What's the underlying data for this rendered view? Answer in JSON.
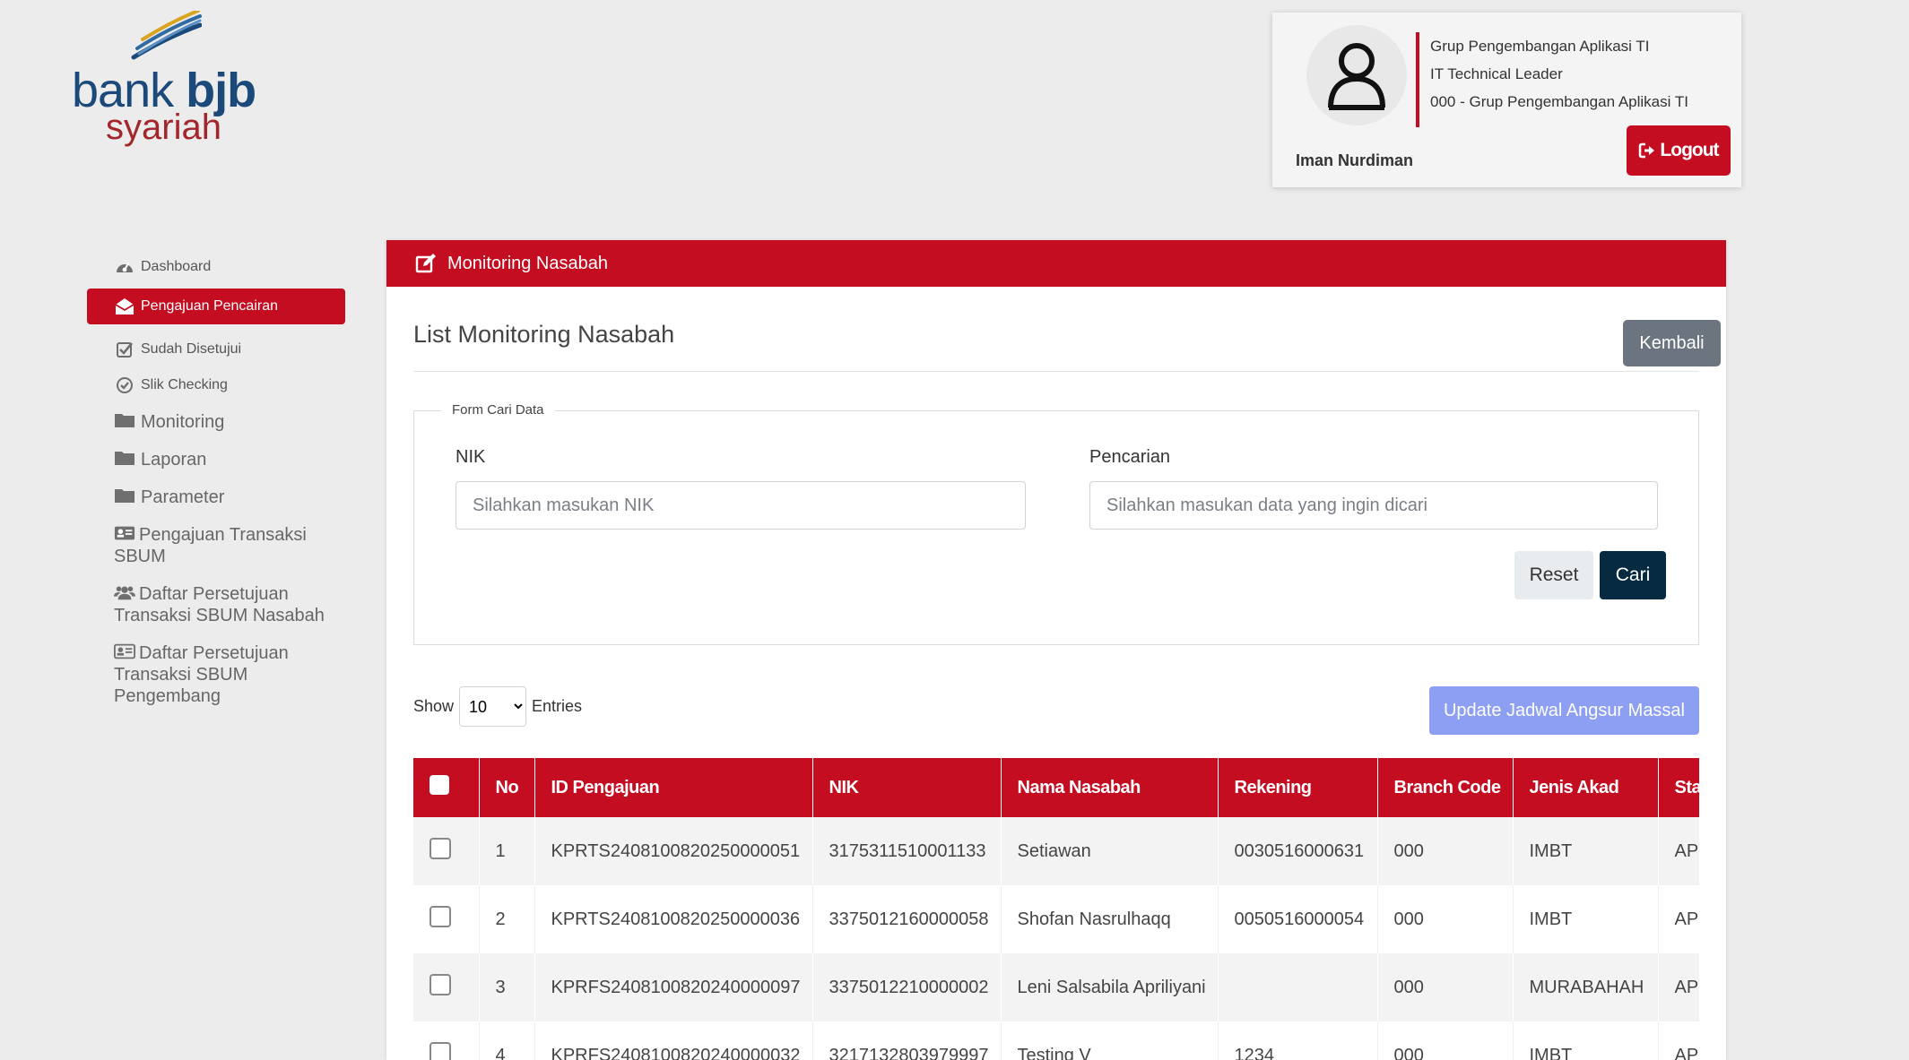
{
  "brand": {
    "bank_word": "bank",
    "bjb_word": "bjb",
    "syariah_word": "syariah"
  },
  "profile": {
    "name": "Iman Nurdiman",
    "info": [
      "Grup Pengembangan Aplikasi TI",
      "IT Technical Leader",
      "000 - Grup Pengembangan Aplikasi TI"
    ],
    "logout_label": "Logout"
  },
  "sidebar": {
    "items": [
      {
        "label": "Dashboard",
        "icon": "dashboard-icon"
      },
      {
        "label": "Pengajuan Pencairan",
        "icon": "envelope-open-icon",
        "active": true
      },
      {
        "label": "Sudah Disetujui",
        "icon": "check-square-icon"
      },
      {
        "label": "Slik Checking",
        "icon": "check-circle-icon"
      },
      {
        "label": "Monitoring",
        "icon": "folder-icon"
      },
      {
        "label": "Laporan",
        "icon": "folder-icon"
      },
      {
        "label": "Parameter",
        "icon": "folder-icon"
      },
      {
        "label": "Pengajuan Transaksi SBUM",
        "icon": "id-card-icon"
      },
      {
        "label": "Daftar Persetujuan Transaksi SBUM Nasabah",
        "icon": "users-icon"
      },
      {
        "label": "Daftar Persetujuan Transaksi SBUM Pengembang",
        "icon": "id-card-icon"
      }
    ]
  },
  "main": {
    "header_title": "Monitoring Nasabah",
    "list_title": "List Monitoring Nasabah",
    "back_label": "Kembali",
    "search": {
      "legend": "Form Cari Data",
      "nik_label": "NIK",
      "nik_placeholder": "Silahkan masukan NIK",
      "query_label": "Pencarian",
      "query_placeholder": "Silahkan masukan data yang ingin dicari",
      "reset_label": "Reset",
      "submit_label": "Cari"
    },
    "entries": {
      "show_label": "Show",
      "value": "10",
      "suffix_label": "Entries"
    },
    "bulk_update_label": "Update Jadwal Angsur Massal",
    "table": {
      "columns": [
        "No",
        "ID Pengajuan",
        "NIK",
        "Nama Nasabah",
        "Rekening",
        "Branch Code",
        "Jenis Akad",
        "Sta"
      ],
      "rows": [
        [
          "1",
          "KPRTS2408100820250000051",
          "3175311510001133",
          "Setiawan",
          "0030516000631",
          "000",
          "IMBT",
          "API"
        ],
        [
          "2",
          "KPRTS2408100820250000036",
          "3375012160000058",
          "Shofan Nasrulhaqq",
          "0050516000054",
          "000",
          "IMBT",
          "API"
        ],
        [
          "3",
          "KPRFS2408100820240000097",
          "3375012210000002",
          "Leni Salsabila Apriliyani",
          "",
          "000",
          "MURABAHAH",
          "API"
        ],
        [
          "4",
          "KPRFS2408100820240000032",
          "3217132803979997",
          "Testing V",
          "1234",
          "000",
          "IMBT",
          "API"
        ]
      ]
    }
  },
  "colors": {
    "brand_red": "#c40d20",
    "dark_button": "#062b40",
    "secondary_button": "#6c7480",
    "disabled_primary": "#8d9ff2",
    "logo_blue": "#1b4a7a",
    "logo_red": "#a3262a"
  }
}
